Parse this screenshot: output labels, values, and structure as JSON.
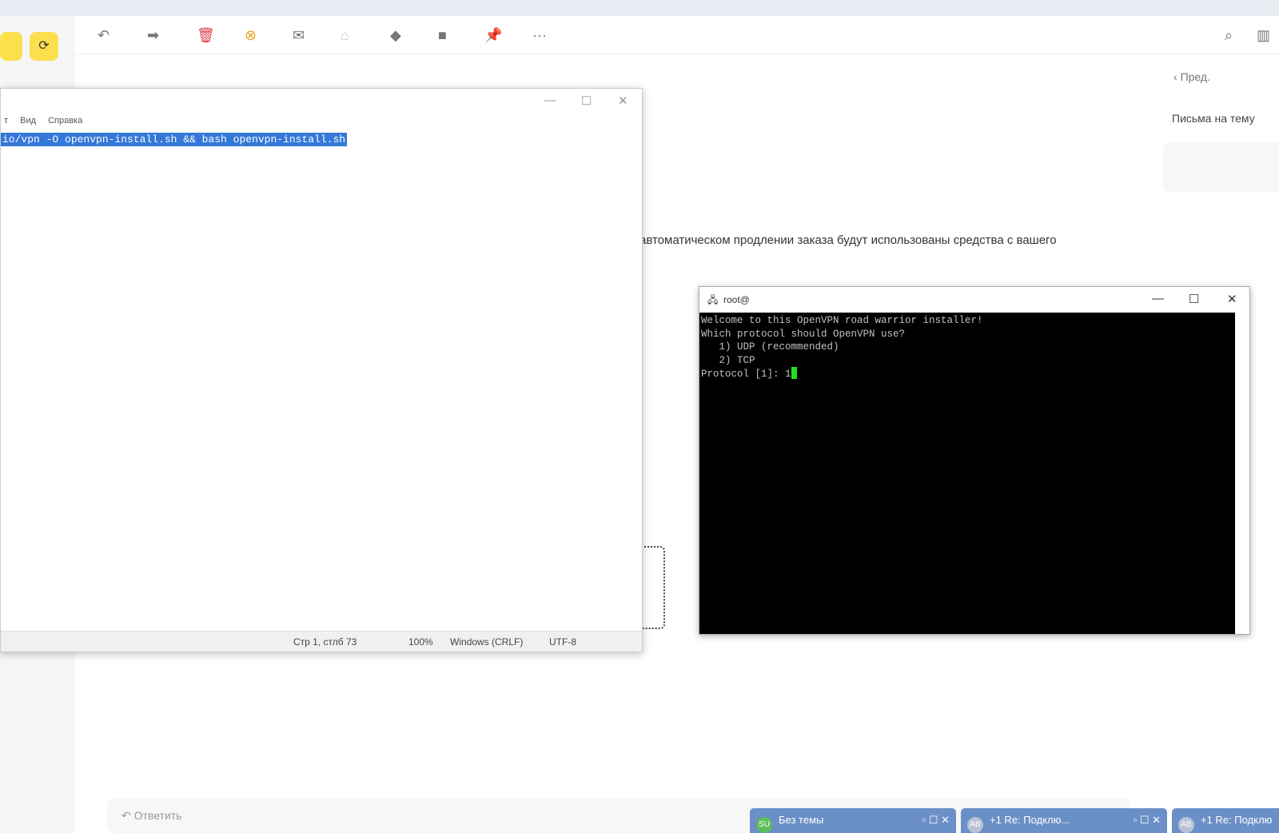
{
  "toolbar": {
    "icons": [
      "reply-icon",
      "forward-icon",
      "delete-icon",
      "spam-icon",
      "mark-read-icon",
      "archive-icon",
      "label-icon",
      "folder-icon",
      "pin-icon",
      "more-icon"
    ],
    "more": "···"
  },
  "mail": {
    "prev": "Пред.",
    "topic": "Письма на тему",
    "body": "автоматическом продлении заказа будут использованы средства с вашего",
    "reply": "Ответить"
  },
  "notepad": {
    "menu": [
      "т",
      "Вид",
      "Справка"
    ],
    "text": "io/vpn -O openvpn-install.sh && bash openvpn-install.sh",
    "status": {
      "pos": "Стр 1, стлб 73",
      "zoom": "100%",
      "eol": "Windows (CRLF)",
      "enc": "UTF-8"
    }
  },
  "putty": {
    "title": "root@",
    "lines": [
      "Welcome to this OpenVPN road warrior installer!",
      "",
      "Which protocol should OpenVPN use?",
      "   1) UDP (recommended)",
      "   2) TCP"
    ],
    "prompt": "Protocol [1]: 1"
  },
  "tasks": [
    {
      "avatar": "SU",
      "label": "Без темы",
      "color": "#5cbf5c"
    },
    {
      "avatar": "AB",
      "label": "+1  Re: Подклю...",
      "color": "#b9c3d6"
    },
    {
      "avatar": "AB",
      "label": "+1  Re: Подклю",
      "color": "#b9c3d6"
    }
  ],
  "colors": {
    "accent": "#fcdf4c",
    "selection": "#3478d8",
    "taskbar": "#6b8fc7"
  }
}
